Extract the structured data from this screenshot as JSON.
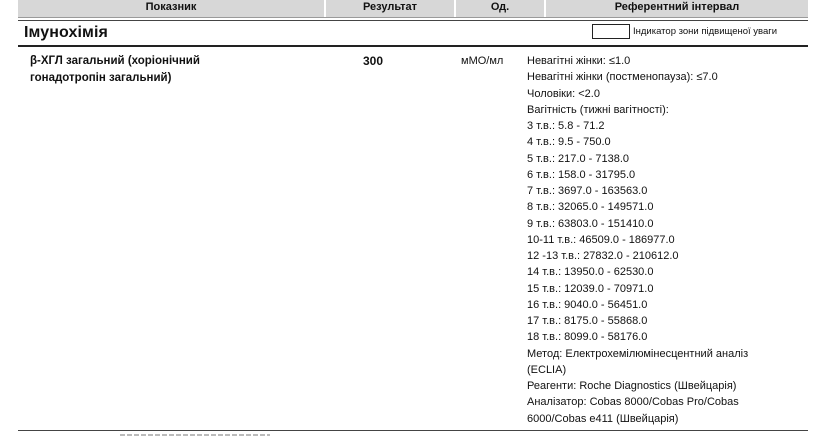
{
  "header": {
    "name_label": "Показник",
    "result_label": "Результат",
    "unit_label": "Од.",
    "reference_label": "Референтний інтервал"
  },
  "section": {
    "title": "Імунохімія",
    "indicator_label": "Індикатор зони підвищеної уваги"
  },
  "test": {
    "name_lines": [
      "β-ХГЛ загальний (хоріонічний",
      "гонадотропін загальний)"
    ],
    "result": "300",
    "unit": "мМО/мл",
    "reference_lines": [
      "Невагітні жінки: ≤1.0",
      "Невагітні жінки (постменопауза): ≤7.0",
      "Чоловіки: <2.0",
      "Вагітність (тижні вагітності):",
      "3 т.в.: 5.8 - 71.2",
      "4 т.в.: 9.5 - 750.0",
      "5 т.в.: 217.0 - 7138.0",
      "6 т.в.: 158.0 - 31795.0",
      "7 т.в.: 3697.0 - 163563.0",
      "8 т.в.: 32065.0 - 149571.0",
      "9 т.в.: 63803.0 - 151410.0",
      "10-11 т.в.: 46509.0 - 186977.0",
      "12 -13 т.в.: 27832.0 - 210612.0",
      "14 т.в.: 13950.0 - 62530.0",
      "15 т.в.: 12039.0 - 70971.0",
      "16 т.в.: 9040.0 - 56451.0",
      "17 т.в.: 8175.0 - 55868.0",
      "18 т.в.: 8099.0 - 58176.0",
      "Метод: Електрохемілюмінесцентний аналіз",
      "(ECLIA)",
      "Реагенти: Roche Diagnostics (Швейцарія)",
      "Аналізатор: Cobas 8000/Cobas Pro/Cobas",
      "6000/Cobas e411 (Швейцарія)"
    ]
  },
  "colors": {
    "header_bg": "#d7d7d7",
    "text": "#111111",
    "rule": "#222222"
  }
}
